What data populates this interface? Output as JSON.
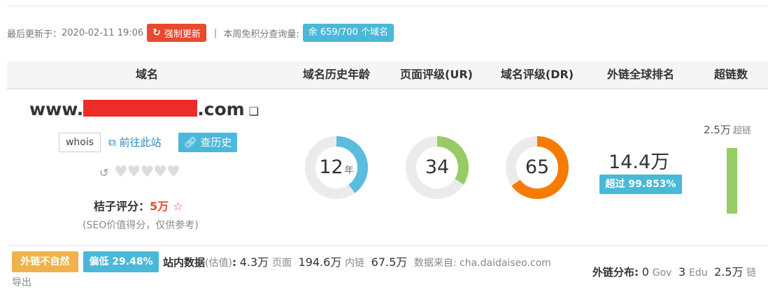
{
  "update_bar": {
    "last_update_label": "最后更新于：",
    "last_update_time": "2020-02-11 19:06",
    "force_update_label": "强制更新",
    "separator": "|",
    "quota_label": "本周免积分查询量:",
    "quota_badge": "余 659/700 个域名"
  },
  "table_header": [
    "域名",
    "域名历史年龄",
    "页面评级(UR)",
    "域名评级(DR)",
    "外链全球排名",
    "超链数"
  ],
  "domain": {
    "prefix": "www.",
    "suffix": ".com",
    "whois_label": "whois",
    "visit_label": "前往此站",
    "history_label": "查历史",
    "score_label": "桔子评分：",
    "score_value": "5万",
    "score_note": "(SEO价值得分，仅供参考)"
  },
  "metrics": {
    "age": {
      "value": "12",
      "unit": "年",
      "fraction": 0.4,
      "color": "#5bbcde"
    },
    "ur": {
      "value": "34",
      "fraction": 0.34,
      "color": "#96cc63"
    },
    "dr": {
      "value": "65",
      "fraction": 0.65,
      "color": "#f57c00"
    }
  },
  "ranking": {
    "value": "14.4万",
    "badge": "超过 99.853%"
  },
  "backlinks": {
    "value": "2.5万",
    "unit": "超链",
    "bar_color": "#96cc63"
  },
  "bottom": {
    "tag_unnatural": "外链不自然",
    "tag_low": "偏低 29.48%",
    "site_data_label": "站内数据",
    "site_data_est": "(估值)",
    "colon": ":",
    "pages_value": "4.3万",
    "pages_label": "页面",
    "internal_value": "194.6万",
    "internal_label": "内链",
    "other_value": "67.5万",
    "source_label": "数据来自: cha.daidaiseo.com",
    "export_label": "导出",
    "dist_label": "外链分布:",
    "gov_value": "0",
    "gov_label": "Gov",
    "edu_value": "3",
    "edu_label": "Edu",
    "other_dist_value": "2.5万",
    "other_dist_label": "链"
  }
}
